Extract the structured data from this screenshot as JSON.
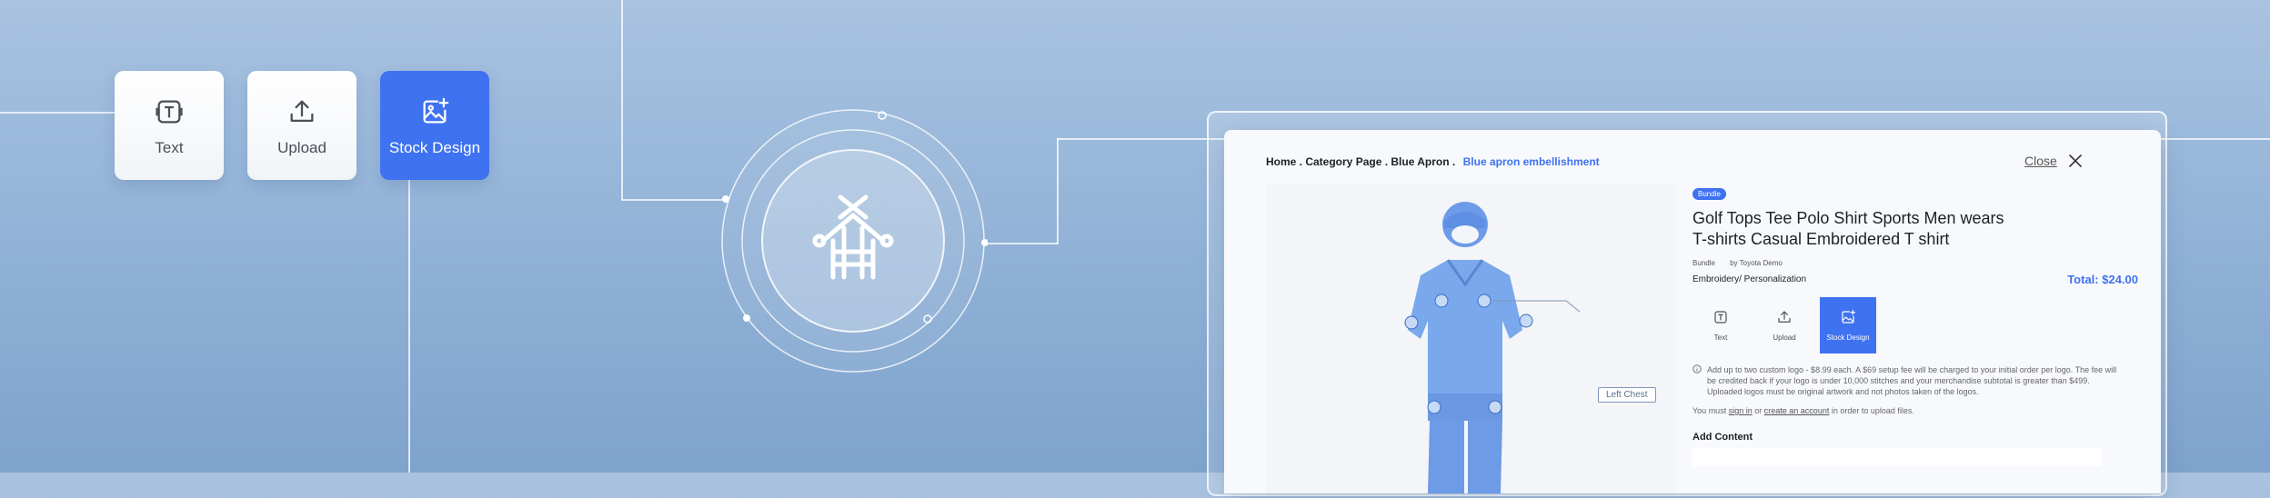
{
  "toolbar": {
    "items": [
      {
        "label": "Text",
        "icon": "text-icon"
      },
      {
        "label": "Upload",
        "icon": "upload-icon"
      },
      {
        "label": "Stock Design",
        "icon": "stock-design-icon",
        "active": true
      }
    ]
  },
  "hub": {
    "icon": "apron-icon"
  },
  "panel": {
    "breadcrumb": {
      "path": "Home . Category Page . Blue Apron .",
      "current": "Blue apron embellishment"
    },
    "close_label": "Close",
    "preview": {
      "callout": "Left Chest"
    },
    "product": {
      "badge": "Bundle",
      "title": "Golf Tops Tee Polo Shirt Sports Men wears T-shirts Casual Embroidered T shirt",
      "type": "Bundle",
      "vendor": "by Toyota Demo",
      "category": "Embroidery/ Personalization",
      "total": "Total: $24.00"
    },
    "tools": [
      {
        "label": "Text",
        "icon": "text-icon"
      },
      {
        "label": "Upload",
        "icon": "upload-icon"
      },
      {
        "label": "Stock Design",
        "icon": "stock-design-icon",
        "active": true
      }
    ],
    "info_text": "Add up to two custom logo - $8.99 each. A $69 setup fee will be charged to your initial order per logo. The fee will be credited back if your logo is under 10,000 stitches and your merchandise subtotal is greater than $499. Uploaded logos must be original artwork and not photos taken of the logos.",
    "auth": {
      "prefix": "You must",
      "sign_in": "sign in",
      "or": "or",
      "create": "create an account",
      "suffix": "in order to upload files."
    },
    "add_content_label": "Add Content"
  },
  "colors": {
    "accent": "#3f72f0",
    "background": "#94b4d8"
  }
}
